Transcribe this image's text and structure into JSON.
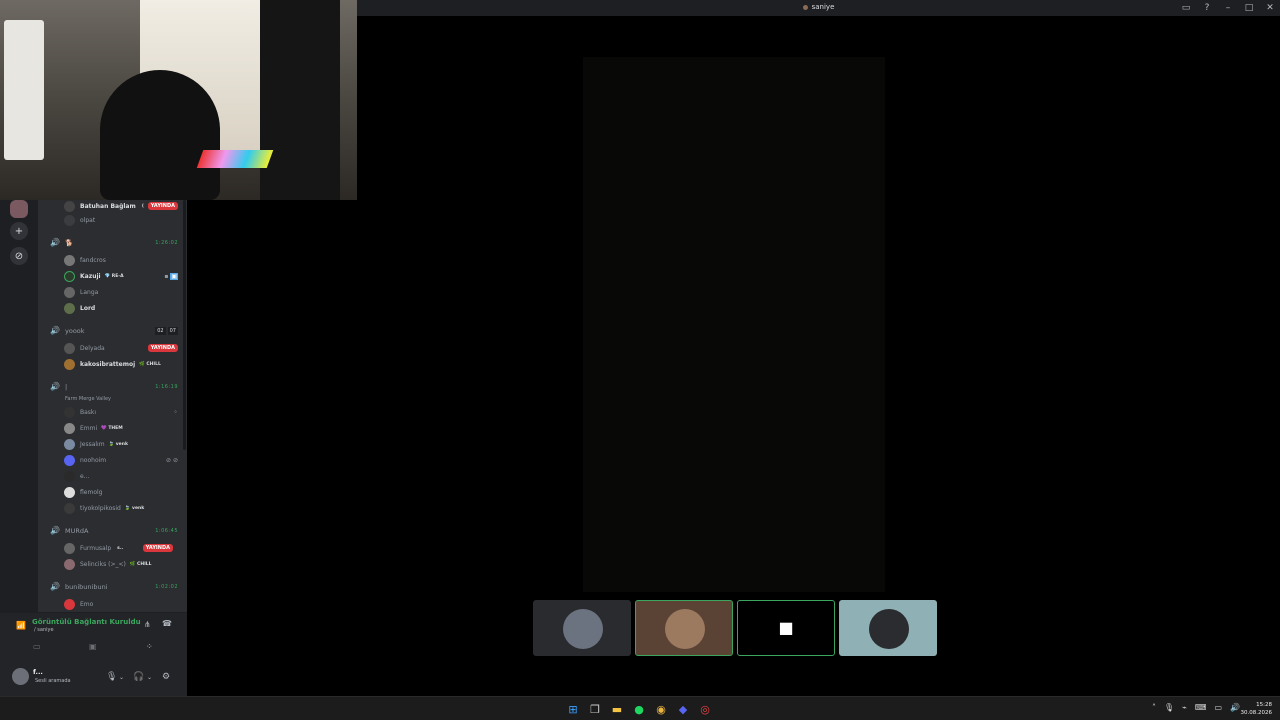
{
  "window": {
    "title": "saniye"
  },
  "title_icons": [
    "inbox-icon",
    "help-icon",
    "minimize-icon",
    "maximize-icon",
    "close-icon"
  ],
  "channels": [
    {
      "name": "",
      "timer": "1:26:02",
      "activity": ""
    },
    {
      "name": "yoook",
      "limits": [
        "02",
        "07"
      ]
    },
    {
      "name": "|",
      "timer": "1:16:19",
      "activity": "Farm Merge Valley"
    },
    {
      "name": "MURdA",
      "timer": "1:06:45"
    },
    {
      "name": "bunibunibuni",
      "timer": "1:02:02"
    }
  ],
  "users": {
    "batuhan": {
      "name": "Batuhan Bağlam",
      "tag": "(",
      "live": "YAYINDA"
    },
    "olpat": {
      "name": "olpat"
    },
    "fandcros": {
      "name": "fandcros"
    },
    "kazuji": {
      "name": "Kazuji",
      "tag": "RE-A"
    },
    "langa": {
      "name": "Langa"
    },
    "lord": {
      "name": "Lord"
    },
    "delyada": {
      "name": "Delyada",
      "live": "YAYINDA"
    },
    "kakosibrattemoj": {
      "name": "kakosibrattemoj",
      "tag": "CHILL"
    },
    "baski": {
      "name": "Baskı"
    },
    "emmi": {
      "name": "Emmi",
      "tag": "THEM"
    },
    "jessalm": {
      "name": "Jessalım",
      "tag": "venk"
    },
    "noohoim": {
      "name": "noohoim"
    },
    "dots": {
      "name": "e..."
    },
    "flemolg": {
      "name": "flemolg"
    },
    "tiyokolpikosid": {
      "name": "tiyokolpikosid",
      "tag": "venk"
    },
    "furmusalp": {
      "name": "Furmusalp",
      "tag": "s..",
      "live": "YAYINDA"
    },
    "selinciks": {
      "name": "Selinciks (>_<)",
      "tag": "CHILL"
    },
    "emo": {
      "name": "Emo"
    }
  },
  "voice_panel": {
    "status": "Görüntülü Bağlantı Kuruldu",
    "channel": "/ saniye"
  },
  "user_panel": {
    "name": "f...",
    "status": "Sesli aramada"
  },
  "tiles": [
    {
      "name": "tile-1",
      "color": "#6b7380"
    },
    {
      "name": "tile-2",
      "color": "#9c7a60"
    },
    {
      "name": "tile-3",
      "color": "#000000"
    },
    {
      "name": "tile-4",
      "color": "#a9c4c8"
    }
  ],
  "clock": {
    "time": "15:28",
    "date": "30.08.2026"
  }
}
